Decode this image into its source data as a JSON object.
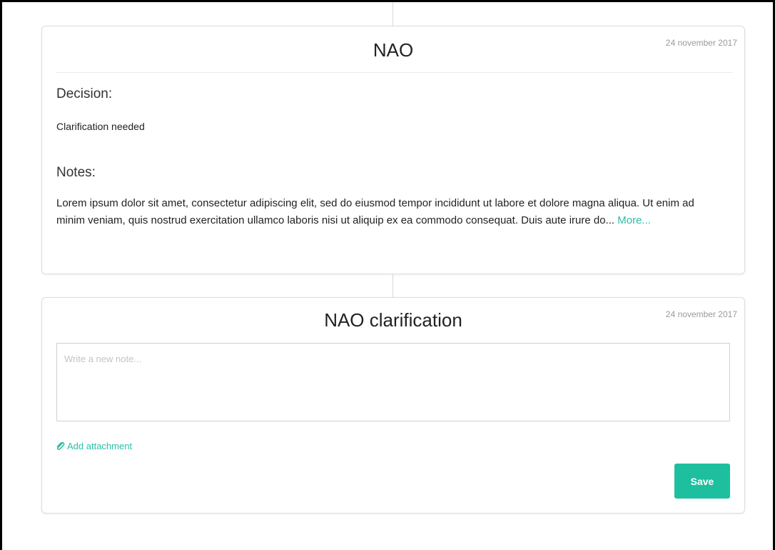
{
  "colors": {
    "accent": "#1dbf9f",
    "link": "#2bbfa6",
    "date_text": "#9a9a9a",
    "border": "#dcdcdc"
  },
  "timeline": {
    "entries": [
      {
        "title": "NAO",
        "date": "24 november 2017",
        "decision_label": "Decision:",
        "decision_value": "Clarification needed",
        "notes_label": "Notes:",
        "notes_text": "Lorem ipsum dolor sit amet, consectetur adipiscing elit, sed do eiusmod tempor incididunt ut labore et dolore magna aliqua. Ut enim ad minim veniam, quis nostrud exercitation ullamco laboris nisi ut aliquip ex ea commodo consequat. Duis aute irure do...",
        "more_link": "More..."
      },
      {
        "title": "NAO clarification",
        "date": "24 november 2017",
        "note_placeholder": "Write a new note...",
        "note_value": "",
        "attach_icon": "paperclip-icon",
        "attach_label": "Add attachment",
        "save_label": "Save"
      }
    ]
  }
}
